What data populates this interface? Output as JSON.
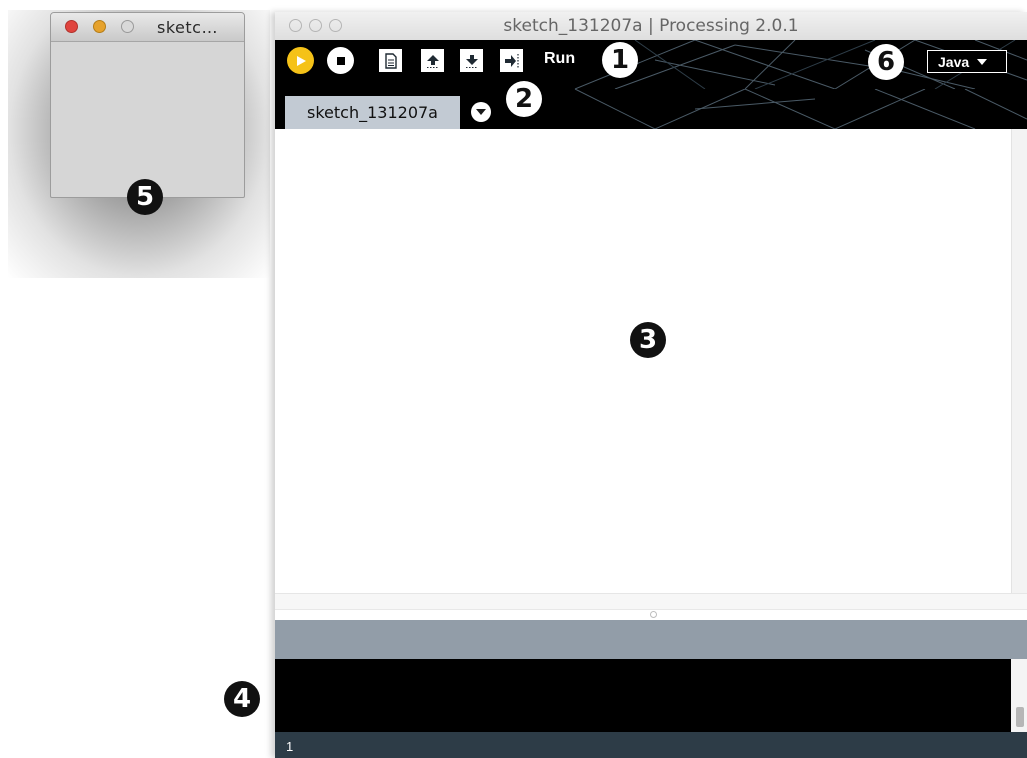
{
  "sketch_window": {
    "title": "sketc…"
  },
  "main_window": {
    "title": "sketch_131207a | Processing 2.0.1"
  },
  "toolbar": {
    "hover_label": "Run",
    "buttons": [
      {
        "name": "run",
        "icon": "play-icon"
      },
      {
        "name": "stop",
        "icon": "stop-icon"
      },
      {
        "name": "new",
        "icon": "document-icon"
      },
      {
        "name": "open",
        "icon": "up-arrow-icon"
      },
      {
        "name": "save",
        "icon": "down-arrow-icon"
      },
      {
        "name": "export",
        "icon": "export-arrow-icon"
      }
    ],
    "mode": "Java"
  },
  "tabs": {
    "active_tab": "sketch_131207a"
  },
  "editor": {
    "content": ""
  },
  "statusbar": {
    "line_number": "1"
  },
  "callouts": {
    "toolbar": "1",
    "tabs": "2",
    "editor": "3",
    "console": "4",
    "sketch_window": "5",
    "mode": "6"
  },
  "colors": {
    "run_button": "#f5c218",
    "toolbar_bg": "#000000",
    "tab_bg": "#c2cad3",
    "message_area": "#929da8",
    "statusbar": "#2d3c47"
  }
}
